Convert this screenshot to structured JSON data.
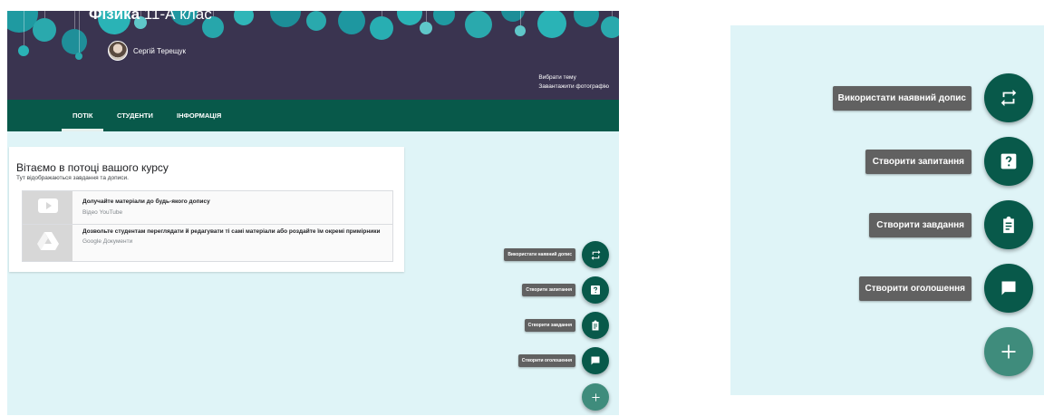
{
  "course": {
    "subject": "Фізика",
    "class_name": "11-А клас",
    "teacher": "Сергій Терещук"
  },
  "banner_links": [
    "Вибрати тему",
    "Завантажити фотографію"
  ],
  "tabs": [
    {
      "label": "ПОТІК",
      "active": true
    },
    {
      "label": "СТУДЕНТИ",
      "active": false
    },
    {
      "label": "ІНФОРМАЦІЯ",
      "active": false
    }
  ],
  "welcome": {
    "title": "Вітаємо в потоці вашого курсу",
    "subtitle": "Тут відображаються завдання та дописи.",
    "tips": [
      {
        "icon": "youtube-play-icon",
        "main": "Долучайте матеріали до будь-якого допису",
        "sub": "Відео YouTube"
      },
      {
        "icon": "google-drive-icon",
        "main": "Дозвольте студентам переглядати й редагувати ті самі матеріали або роздайте їм окремі примірники",
        "sub": "Google Документи"
      }
    ]
  },
  "fab_menu": [
    {
      "label": "Використати наявний допис",
      "icon": "repost-icon"
    },
    {
      "label": "Створити запитання",
      "icon": "question-icon"
    },
    {
      "label": "Створити завдання",
      "icon": "assignment-icon"
    },
    {
      "label": "Створити оголошення",
      "icon": "announcement-icon"
    }
  ],
  "fab_main_icon": "plus-icon",
  "colors": {
    "primary": "#08594a",
    "fab_main": "#3f8c7c",
    "stream_bg": "#dff4f7",
    "banner": "#3a3450",
    "label_bg": "#616161"
  }
}
